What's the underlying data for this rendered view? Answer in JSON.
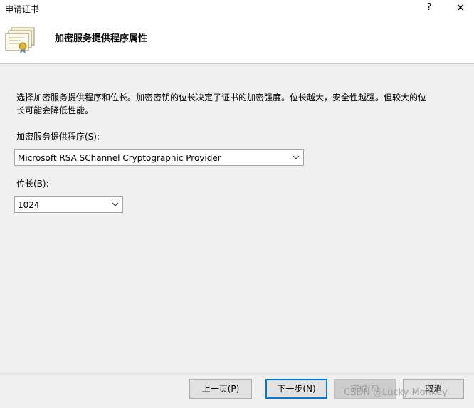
{
  "window": {
    "title": "申请证书",
    "help_label": "?",
    "close_label": "✕"
  },
  "header": {
    "heading": "加密服务提供程序属性",
    "icon": "certificate-icon"
  },
  "content": {
    "description": "选择加密服务提供程序和位长。加密密钥的位长决定了证书的加密强度。位长越大，安全性越强。但较大的位长可能会降低性能。",
    "csp_label": "加密服务提供程序(S):",
    "csp_value": "Microsoft RSA SChannel Cryptographic Provider",
    "bitlength_label": "位长(B):",
    "bitlength_value": "1024"
  },
  "buttons": {
    "prev": "上一页(P)",
    "next": "下一步(N)",
    "finish": "完成(F)",
    "cancel": "取消"
  },
  "watermark": "CSDN @Lucky Monkey",
  "colors": {
    "accent": "#0078d7",
    "dialog_bg": "#f0f0f0"
  }
}
